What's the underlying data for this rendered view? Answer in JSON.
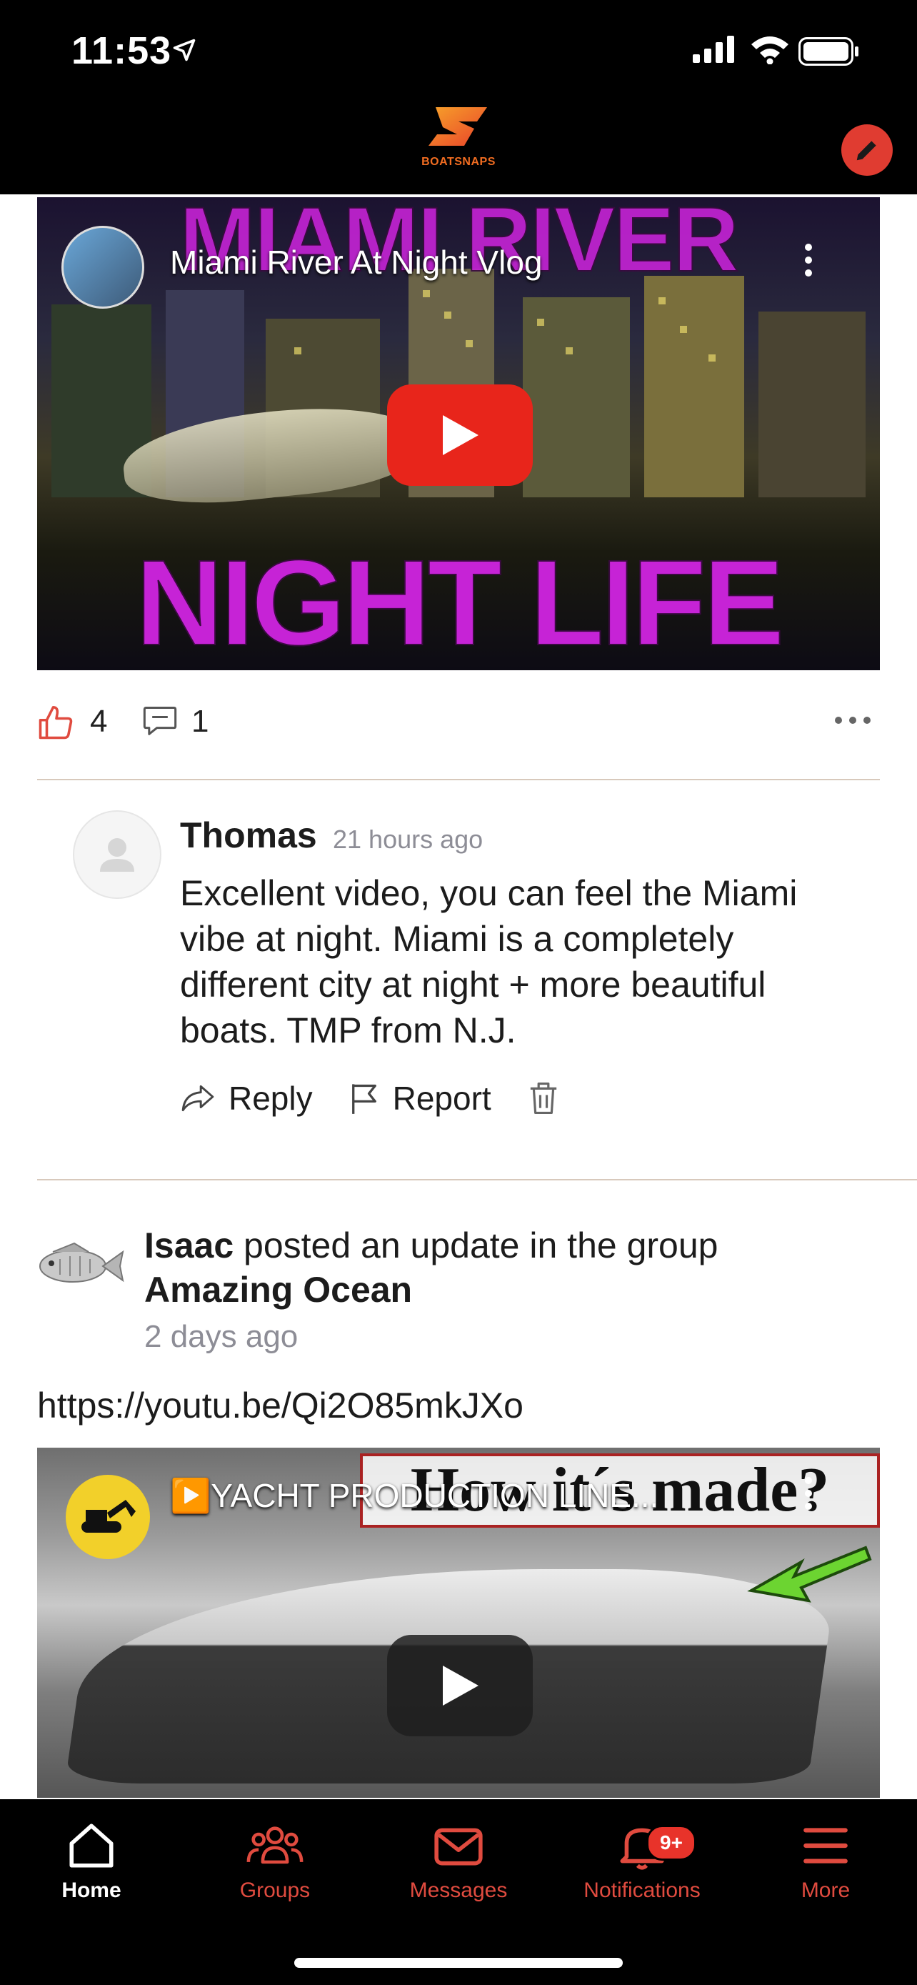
{
  "status": {
    "time": "11:53"
  },
  "header": {
    "logo_text": "BOATSNAPS"
  },
  "video1": {
    "overlay_top": "MIAMI RIVER",
    "overlay_bottom": "NIGHT LIFE",
    "title": "Miami River At Night Vlog"
  },
  "reactions": {
    "likes": "4",
    "comments": "1"
  },
  "comment": {
    "author": "Thomas",
    "time": "21 hours ago",
    "text": "Excellent video, you can feel the Miami vibe at night. Miami is a completely different city at night + more beautiful boats. TMP from N.J.",
    "reply_label": "Reply",
    "report_label": "Report"
  },
  "post": {
    "author": "Isaac",
    "action": "posted an update in the group",
    "group": "Amazing Ocean",
    "time": "2 days ago",
    "link": "https://youtu.be/Qi2O85mkJXo"
  },
  "video2": {
    "overlay": "How it´s made?",
    "title": "▶️YACHT PRODUCTION LINE..."
  },
  "nav": {
    "items": [
      {
        "label": "Home",
        "icon": "home-icon"
      },
      {
        "label": "Groups",
        "icon": "groups-icon"
      },
      {
        "label": "Messages",
        "icon": "messages-icon"
      },
      {
        "label": "Notifications",
        "icon": "bell-icon",
        "badge": "9+"
      },
      {
        "label": "More",
        "icon": "menu-icon"
      }
    ]
  },
  "colors": {
    "accent": "#e04b3f",
    "brand_orange": "#f26d21",
    "play_red": "#e8251b"
  }
}
